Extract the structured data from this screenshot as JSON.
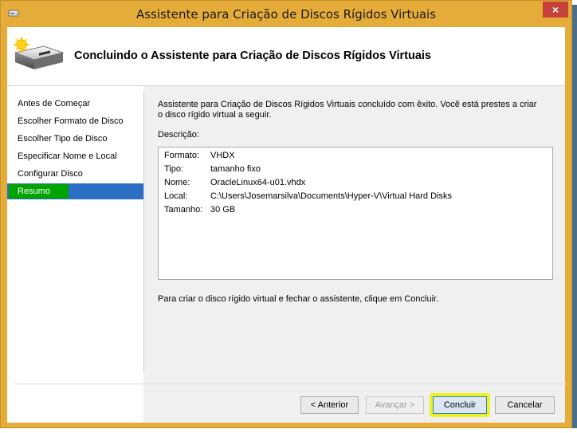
{
  "window": {
    "title": "Assistente para Criação de Discos Rígidos Virtuais",
    "close_label": "×"
  },
  "header": {
    "title": "Concluindo o Assistente para Criação de Discos Rígidos Virtuais"
  },
  "nav": {
    "items": [
      {
        "label": "Antes de Começar",
        "active": false
      },
      {
        "label": "Escolher Formato de Disco",
        "active": false
      },
      {
        "label": "Escolher Tipo de Disco",
        "active": false
      },
      {
        "label": "Especificar Nome e Local",
        "active": false
      },
      {
        "label": "Configurar Disco",
        "active": false
      },
      {
        "label": "Resumo",
        "active": true
      }
    ]
  },
  "main": {
    "intro": "Assistente para Criação de Discos Rígidos Virtuais concluído com êxito. Você está prestes a criar o disco rígido virtual a seguir.",
    "description_label": "Descrição:",
    "description": [
      {
        "key": "Formato:",
        "value": "VHDX"
      },
      {
        "key": "Tipo:",
        "value": "tamanho fixo"
      },
      {
        "key": "Nome:",
        "value": "OracleLinux64-u01.vhdx"
      },
      {
        "key": "Local:",
        "value": "C:\\Users\\Josemarsilva\\Documents\\Hyper-V\\Virtual Hard Disks"
      },
      {
        "key": "Tamanho:",
        "value": "30 GB"
      }
    ],
    "finish_text": "Para criar o disco rígido virtual e fechar o assistente, clique em Concluir."
  },
  "buttons": {
    "previous": "< Anterior",
    "next": "Avançar >",
    "finish": "Concluir",
    "cancel": "Cancelar"
  },
  "colors": {
    "title_bar": "#e6ac3a",
    "selection": "#2a6fc4",
    "highlight_green": "#00a400",
    "highlight_yellow": "#e9f326",
    "close_button": "#c7413a"
  },
  "icons": {
    "app": "drive-icon",
    "header": "new-disk-icon"
  }
}
